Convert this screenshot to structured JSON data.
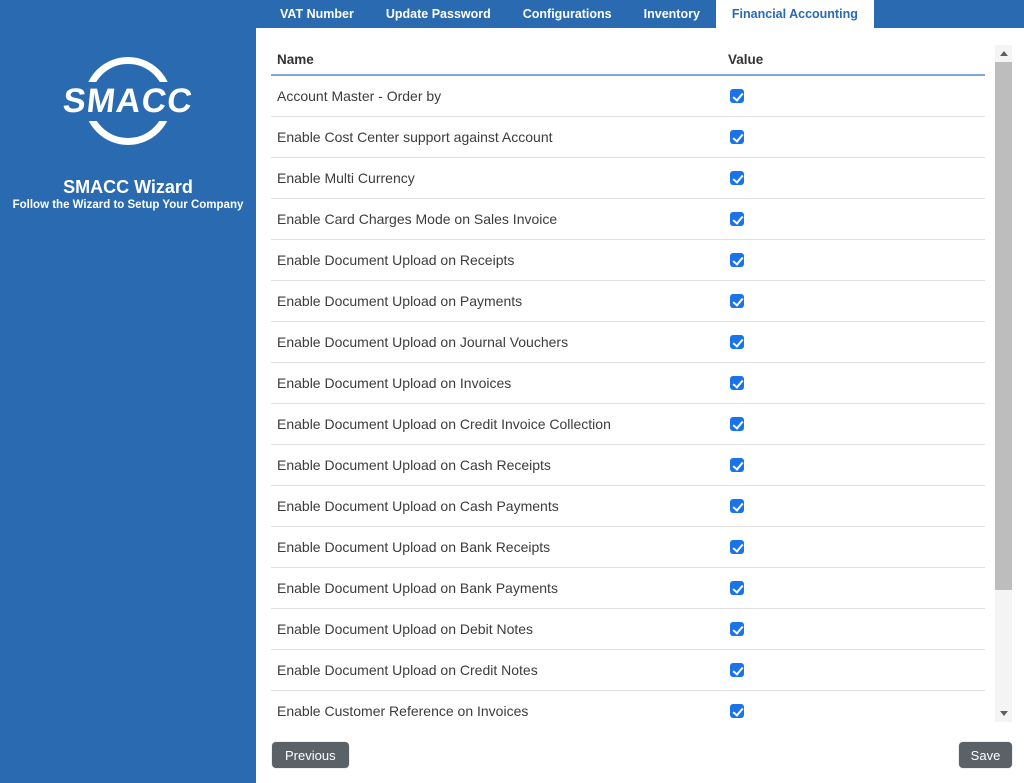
{
  "sidebar": {
    "logo_text": "SMACC",
    "title": "SMACC Wizard",
    "subtitle": "Follow the Wizard to Setup Your Company"
  },
  "tabs": {
    "items": [
      {
        "label": "VAT Number",
        "active": false
      },
      {
        "label": "Update Password",
        "active": false
      },
      {
        "label": "Configurations",
        "active": false
      },
      {
        "label": "Inventory",
        "active": false
      },
      {
        "label": "Financial Accounting",
        "active": true
      }
    ]
  },
  "table": {
    "columns": {
      "name": "Name",
      "value": "Value"
    },
    "rows": [
      {
        "label": "Account Master - Order by",
        "checked": true
      },
      {
        "label": "Enable Cost Center support against Account",
        "checked": true
      },
      {
        "label": "Enable Multi Currency",
        "checked": true
      },
      {
        "label": "Enable Card Charges Mode on Sales Invoice",
        "checked": true
      },
      {
        "label": "Enable Document Upload on Receipts",
        "checked": true
      },
      {
        "label": "Enable Document Upload on Payments",
        "checked": true
      },
      {
        "label": "Enable Document Upload on Journal Vouchers",
        "checked": true
      },
      {
        "label": "Enable Document Upload on Invoices",
        "checked": true
      },
      {
        "label": "Enable Document Upload on Credit Invoice Collection",
        "checked": true
      },
      {
        "label": "Enable Document Upload on Cash Receipts",
        "checked": true
      },
      {
        "label": "Enable Document Upload on Cash Payments",
        "checked": true
      },
      {
        "label": "Enable Document Upload on Bank Receipts",
        "checked": true
      },
      {
        "label": "Enable Document Upload on Bank Payments",
        "checked": true
      },
      {
        "label": "Enable Document Upload on Debit Notes",
        "checked": true
      },
      {
        "label": "Enable Document Upload on Credit Notes",
        "checked": true
      },
      {
        "label": "Enable Customer Reference on Invoices",
        "checked": true
      }
    ]
  },
  "footer": {
    "previous_label": "Previous",
    "save_label": "Save"
  },
  "colors": {
    "primary_blue": "#2a6ab0",
    "checkbox_blue": "#1a73e8",
    "header_border_blue": "#7fa8d8",
    "button_gray": "#5a6268"
  }
}
